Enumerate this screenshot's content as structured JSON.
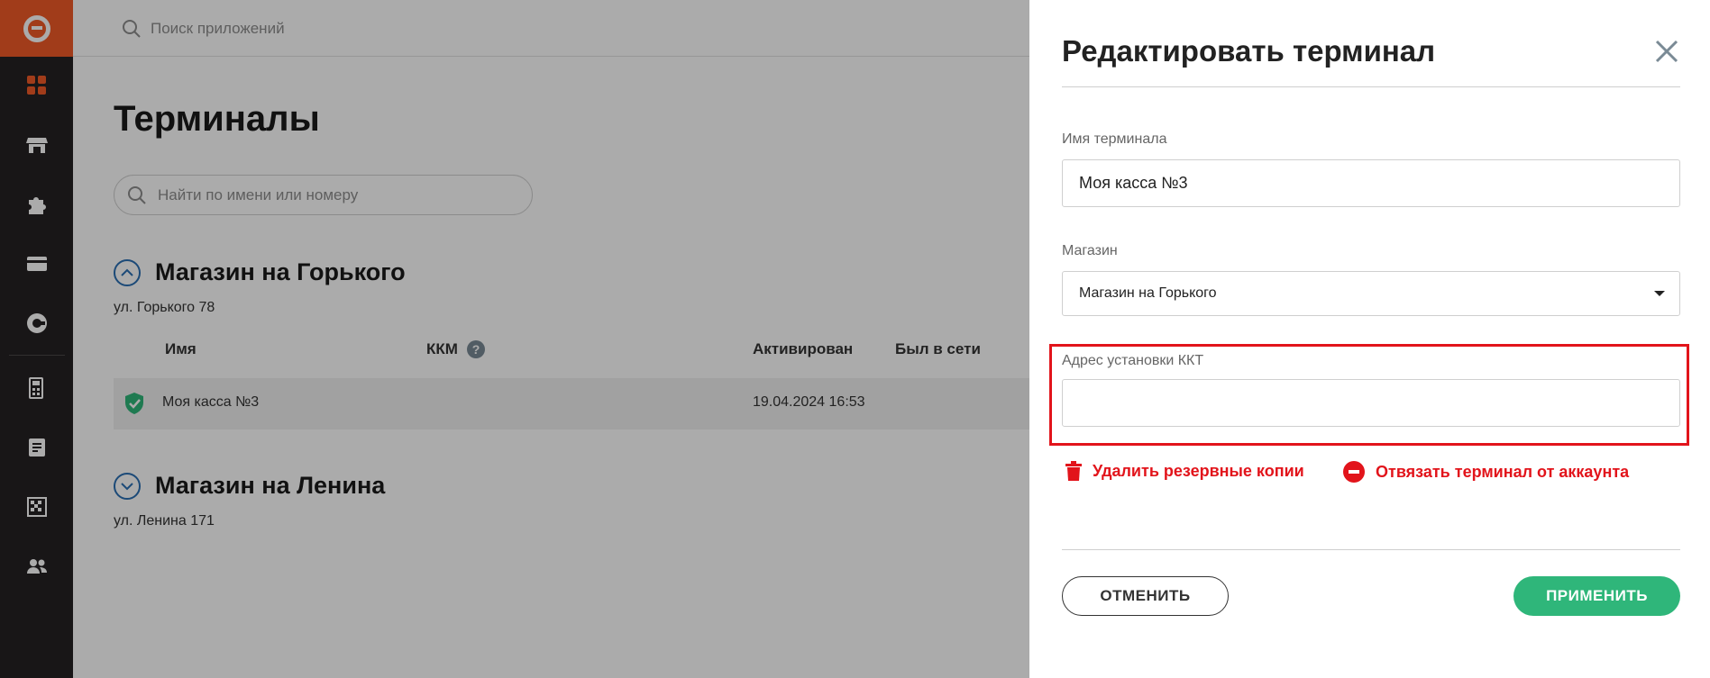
{
  "colors": {
    "brand": "#f05a28",
    "nav_bg": "#252223",
    "accent_green": "#2fb67a",
    "danger": "#e2141b",
    "link_blue": "#2a6fb3"
  },
  "topbar": {
    "app_search_placeholder": "Поиск приложений"
  },
  "sidebar": {
    "icons": [
      "logo-icon",
      "dashboard-icon",
      "store-icon",
      "puzzle-icon",
      "card-icon",
      "integration-icon",
      "terminal-icon",
      "receipt-icon",
      "report-icon",
      "users-icon"
    ]
  },
  "page": {
    "title": "Терминалы",
    "search_placeholder": "Найти по имени или номеру",
    "groups": [
      {
        "title": "Магазин на Горького",
        "address": "ул. Горького 78",
        "columns": {
          "name": "Имя",
          "kkm": "ККМ",
          "activated": "Активирован",
          "online": "Был в сети"
        },
        "rows": [
          {
            "name": "Моя касса №3",
            "activated": "19.04.2024 16:53"
          }
        ]
      },
      {
        "title": "Магазин на Ленина",
        "address": "ул. Ленина 171"
      }
    ]
  },
  "panel": {
    "title": "Редактировать терминал",
    "terminal_name_label": "Имя терминала",
    "terminal_name_value": "Моя касса №3",
    "store_label": "Магазин",
    "store_value": "Магазин на Горького",
    "address_label": "Адрес установки ККТ",
    "address_value": "",
    "delete_backups": "Удалить резервные копии",
    "unlink_terminal": "Отвязать терминал от аккаунта",
    "cancel": "ОТМЕНИТЬ",
    "apply": "ПРИМЕНИТЬ"
  }
}
